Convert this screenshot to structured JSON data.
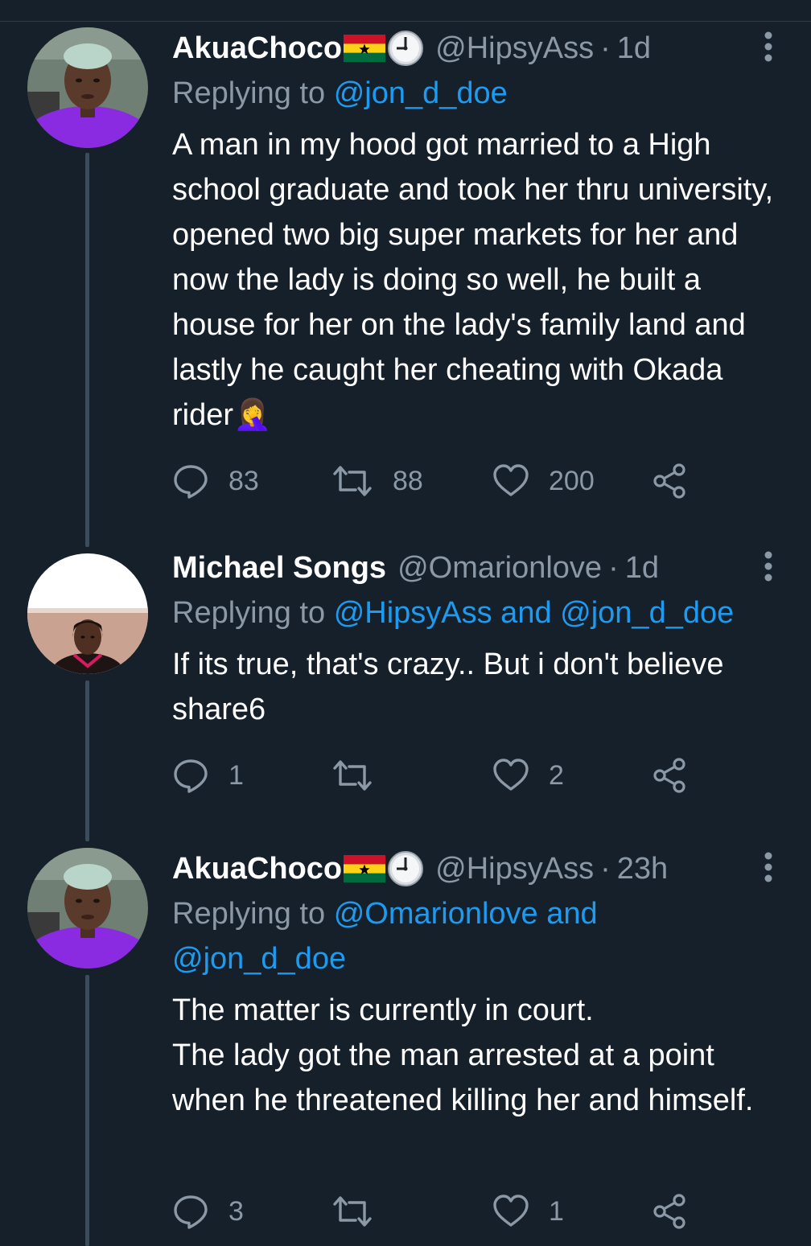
{
  "tweets": [
    {
      "name": "AkuaChoco",
      "handle": "@HipsyAss",
      "sep": "·",
      "time": "1d",
      "reply_prefix": "Replying to",
      "reply_mentions": "@jon_d_doe",
      "text": "A man in my hood got married to a High school graduate and took her thru university, opened two big super markets for her and now the lady is doing so well, he built a house for her on the lady's family land and lastly he caught her cheating with Okada rider🤦‍♀️",
      "stats": {
        "replies": "83",
        "retweets": "88",
        "likes": "200"
      },
      "badges": [
        "ghana-flag",
        "clock"
      ]
    },
    {
      "name": "Michael Songs",
      "handle": "@Omarionlove",
      "sep": "·",
      "time": "1d",
      "reply_prefix": "Replying to",
      "reply_mentions": "@HipsyAss and @jon_d_doe",
      "text": "If its true, that's crazy.. But i don't believe share6",
      "stats": {
        "replies": "1",
        "retweets": "",
        "likes": "2"
      },
      "badges": []
    },
    {
      "name": "AkuaChoco",
      "handle": "@HipsyAss",
      "sep": "·",
      "time": "23h",
      "reply_prefix": "Replying to",
      "reply_mentions": "@Omarionlove and @jon_d_doe",
      "text_lines": [
        "The matter is currently in court.",
        "The lady got the man arrested at a point when he threatened killing her and himself."
      ],
      "stats": {
        "replies": "3",
        "retweets": "",
        "likes": "1"
      },
      "badges": [
        "ghana-flag",
        "clock"
      ]
    }
  ],
  "colors": {
    "background": "#15202b",
    "secondary_text": "#8b98a5",
    "link": "#1d9bf0",
    "thread_line": "#3d4c5a"
  }
}
